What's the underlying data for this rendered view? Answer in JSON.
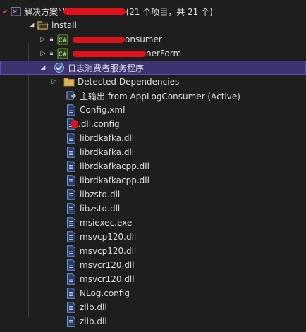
{
  "solution": {
    "label_prefix": "解决方案“”",
    "label_suffix": "(21 个项目，共 21 个)"
  },
  "tree": {
    "folder_install": {
      "label": "install"
    },
    "project_1": {
      "label_suffix": "onsumer",
      "tag": "C#"
    },
    "project_2": {
      "label_suffix": "nerForm",
      "tag": "C#"
    },
    "service": {
      "label": "日志消费者服务程序"
    },
    "detected_deps": {
      "label": "Detected Dependencies"
    },
    "primary_output": {
      "label": "主输出 from AppLogConsumer (Active)"
    },
    "files": [
      "Config.xml",
      ".dll.config",
      "librdkafka.dll",
      "librdkafka.dll",
      "librdkafkacpp.dll",
      "librdkafkacpp.dll",
      "libzstd.dll",
      "libzstd.dll",
      "msiexec.exe",
      "msvcp120.dll",
      "msvcp120.dll",
      "msvcr120.dll",
      "msvcr120.dll",
      "NLog.config",
      "zlib.dll",
      "zlib.dll"
    ]
  },
  "colors": {
    "selection": "#3b3470",
    "background": "#1e1e1e",
    "folder": "#dcb25a",
    "file": "#4f83d6",
    "redaction": "#e1101d",
    "csharp": "#6cb33f"
  }
}
